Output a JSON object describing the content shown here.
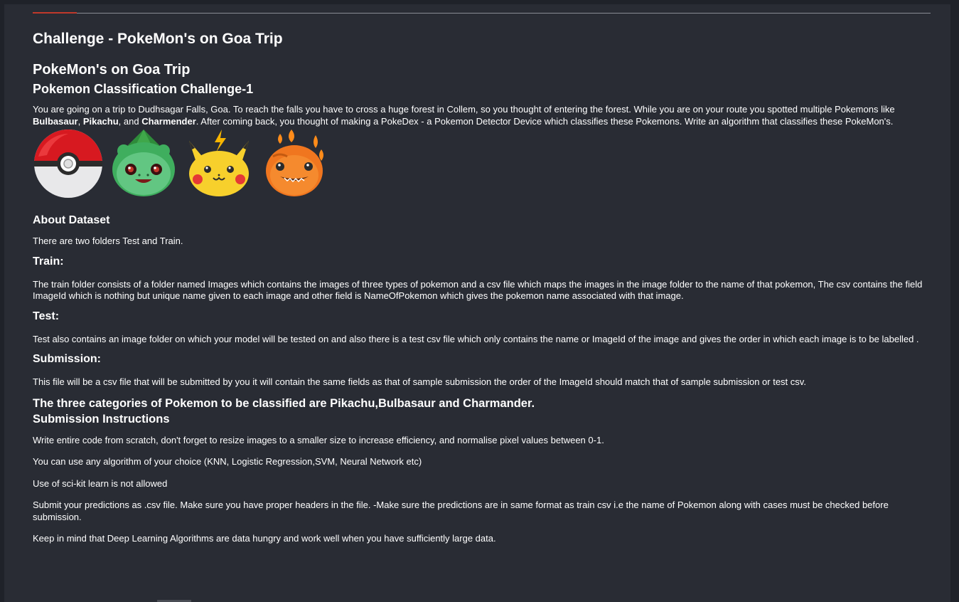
{
  "header": {
    "challenge_title": "Challenge - PokeMon's on Goa Trip",
    "title": "PokeMon's on Goa Trip",
    "subtitle": "Pokemon Classification Challenge-1"
  },
  "intro": {
    "part1": "You are going on a trip to Dudhsagar Falls, Goa. To reach the falls you have to cross a huge forest in Collem, so you thought of entering the forest. While you are on your route you spotted multiple Pokemons like ",
    "bulbasaur": "Bulbasaur",
    "sep1": ", ",
    "pikachu": "Pikachu",
    "sep2": ", and ",
    "charmender": "Charmender",
    "part2": ". After coming back, you thought of making a PokeDex - a Pokemon Detector Device which classifies these Pokemons. Write an algorithm that classifies these PokeMon's."
  },
  "icons": [
    "pokeball-icon",
    "bulbasaur-icon",
    "pikachu-icon",
    "charmander-icon"
  ],
  "colors": {
    "background": "#292c34",
    "accent": "#c0392b",
    "text": "#ffffff"
  },
  "about": {
    "heading": "About Dataset",
    "text": "There are two folders Test and Train."
  },
  "train": {
    "heading": "Train:",
    "text": "The train folder consists of a folder named Images which contains the images of three types of pokemon and a csv file which maps the images in the image folder to the name of that pokemon, The csv contains the field ImageId which is nothing but unique name given to each image and other field is NameOfPokemon which gives the pokemon name associated with that image."
  },
  "test": {
    "heading": "Test:",
    "text": "Test also contains an image folder on which your model will be tested on and also there is a test csv file which only contains the name or ImageId of the image and gives the order in which each image is to be labelled ."
  },
  "submission": {
    "heading": "Submission:",
    "text": "This file will be a csv file that will be submitted by you it will contain the same fields as that of sample submission the order of the ImageId should match that of sample submission or test csv."
  },
  "categories_heading": "The three categories of Pokemon to be classified are Pikachu,Bulbasaur and Charmander.",
  "instructions": {
    "heading": "Submission Instructions",
    "items": [
      "Write entire code from scratch, don't forget to resize images to a smaller size to increase efficiency, and normalise pixel values between 0-1.",
      "You can use any algorithm of your choice (KNN, Logistic Regression,SVM, Neural Network etc)",
      "Use of sci-kit learn is not allowed",
      "Submit your predictions as .csv file. Make sure you have proper headers in the file. -Make sure the predictions are in same format as train csv i.e the name of Pokemon along with cases must be checked before submission.",
      "Keep in mind that Deep Learning Algorithms are data hungry and work well when you have sufficiently large data."
    ]
  }
}
